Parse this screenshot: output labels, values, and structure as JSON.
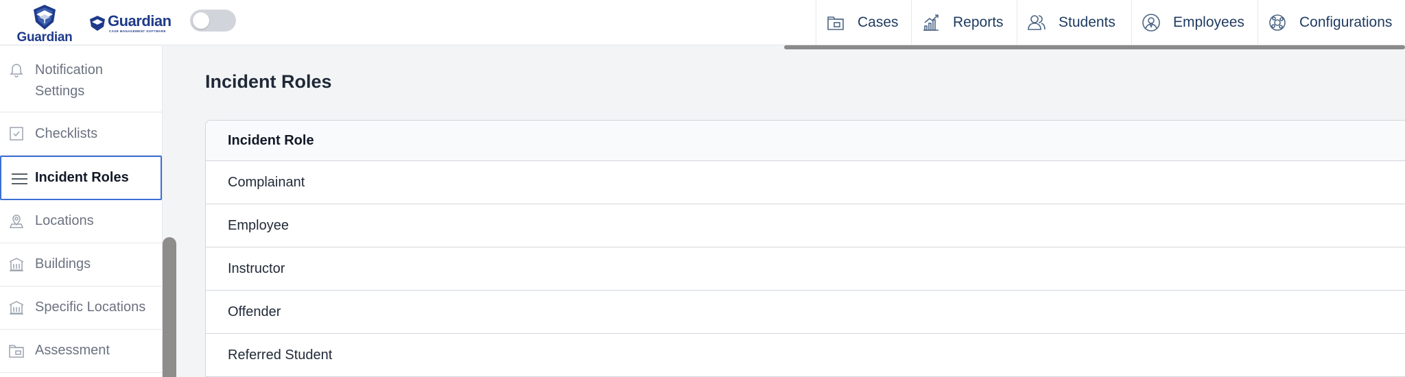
{
  "header": {
    "logo_primary_text": "Guardian",
    "logo_secondary_name": "Guardian",
    "logo_secondary_tagline": "CASE MANAGEMENT SOFTWARE",
    "toggle_state": "off",
    "nav": [
      {
        "label": "Cases",
        "icon": "folder-icon"
      },
      {
        "label": "Reports",
        "icon": "bar-chart-icon"
      },
      {
        "label": "Students",
        "icon": "users-icon"
      },
      {
        "label": "Employees",
        "icon": "employee-icon"
      },
      {
        "label": "Configurations",
        "icon": "settings-icon"
      }
    ]
  },
  "sidebar": {
    "items": [
      {
        "label": "Notification Settings",
        "icon": "bell-icon"
      },
      {
        "label": "Checklists",
        "icon": "checkbox-icon"
      },
      {
        "label": "Incident Roles",
        "icon": "menu-icon",
        "active": true
      },
      {
        "label": "Locations",
        "icon": "map-pin-icon"
      },
      {
        "label": "Buildings",
        "icon": "building-icon"
      },
      {
        "label": "Specific Locations",
        "icon": "building-icon"
      },
      {
        "label": "Assessment",
        "icon": "folder-icon"
      }
    ]
  },
  "main": {
    "title": "Incident Roles",
    "table": {
      "header": "Incident Role",
      "rows": [
        "Complainant",
        "Employee",
        "Instructor",
        "Offender",
        "Referred Student"
      ]
    }
  },
  "colors": {
    "brand": "#1e3a8a",
    "active_border": "#3b6fd4",
    "nav_text": "#1e3a5f"
  }
}
